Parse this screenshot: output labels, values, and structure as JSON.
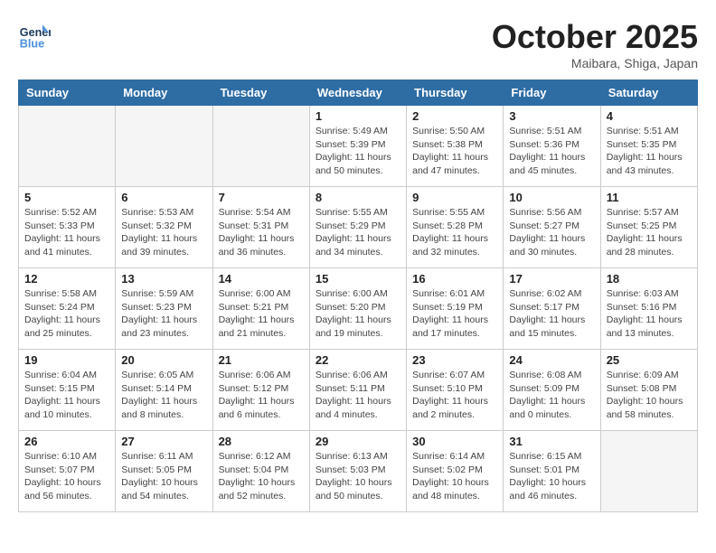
{
  "header": {
    "logo_line1": "General",
    "logo_line2": "Blue",
    "month": "October 2025",
    "location": "Maibara, Shiga, Japan"
  },
  "weekdays": [
    "Sunday",
    "Monday",
    "Tuesday",
    "Wednesday",
    "Thursday",
    "Friday",
    "Saturday"
  ],
  "weeks": [
    [
      {
        "day": "",
        "info": ""
      },
      {
        "day": "",
        "info": ""
      },
      {
        "day": "",
        "info": ""
      },
      {
        "day": "1",
        "info": "Sunrise: 5:49 AM\nSunset: 5:39 PM\nDaylight: 11 hours\nand 50 minutes."
      },
      {
        "day": "2",
        "info": "Sunrise: 5:50 AM\nSunset: 5:38 PM\nDaylight: 11 hours\nand 47 minutes."
      },
      {
        "day": "3",
        "info": "Sunrise: 5:51 AM\nSunset: 5:36 PM\nDaylight: 11 hours\nand 45 minutes."
      },
      {
        "day": "4",
        "info": "Sunrise: 5:51 AM\nSunset: 5:35 PM\nDaylight: 11 hours\nand 43 minutes."
      }
    ],
    [
      {
        "day": "5",
        "info": "Sunrise: 5:52 AM\nSunset: 5:33 PM\nDaylight: 11 hours\nand 41 minutes."
      },
      {
        "day": "6",
        "info": "Sunrise: 5:53 AM\nSunset: 5:32 PM\nDaylight: 11 hours\nand 39 minutes."
      },
      {
        "day": "7",
        "info": "Sunrise: 5:54 AM\nSunset: 5:31 PM\nDaylight: 11 hours\nand 36 minutes."
      },
      {
        "day": "8",
        "info": "Sunrise: 5:55 AM\nSunset: 5:29 PM\nDaylight: 11 hours\nand 34 minutes."
      },
      {
        "day": "9",
        "info": "Sunrise: 5:55 AM\nSunset: 5:28 PM\nDaylight: 11 hours\nand 32 minutes."
      },
      {
        "day": "10",
        "info": "Sunrise: 5:56 AM\nSunset: 5:27 PM\nDaylight: 11 hours\nand 30 minutes."
      },
      {
        "day": "11",
        "info": "Sunrise: 5:57 AM\nSunset: 5:25 PM\nDaylight: 11 hours\nand 28 minutes."
      }
    ],
    [
      {
        "day": "12",
        "info": "Sunrise: 5:58 AM\nSunset: 5:24 PM\nDaylight: 11 hours\nand 25 minutes."
      },
      {
        "day": "13",
        "info": "Sunrise: 5:59 AM\nSunset: 5:23 PM\nDaylight: 11 hours\nand 23 minutes."
      },
      {
        "day": "14",
        "info": "Sunrise: 6:00 AM\nSunset: 5:21 PM\nDaylight: 11 hours\nand 21 minutes."
      },
      {
        "day": "15",
        "info": "Sunrise: 6:00 AM\nSunset: 5:20 PM\nDaylight: 11 hours\nand 19 minutes."
      },
      {
        "day": "16",
        "info": "Sunrise: 6:01 AM\nSunset: 5:19 PM\nDaylight: 11 hours\nand 17 minutes."
      },
      {
        "day": "17",
        "info": "Sunrise: 6:02 AM\nSunset: 5:17 PM\nDaylight: 11 hours\nand 15 minutes."
      },
      {
        "day": "18",
        "info": "Sunrise: 6:03 AM\nSunset: 5:16 PM\nDaylight: 11 hours\nand 13 minutes."
      }
    ],
    [
      {
        "day": "19",
        "info": "Sunrise: 6:04 AM\nSunset: 5:15 PM\nDaylight: 11 hours\nand 10 minutes."
      },
      {
        "day": "20",
        "info": "Sunrise: 6:05 AM\nSunset: 5:14 PM\nDaylight: 11 hours\nand 8 minutes."
      },
      {
        "day": "21",
        "info": "Sunrise: 6:06 AM\nSunset: 5:12 PM\nDaylight: 11 hours\nand 6 minutes."
      },
      {
        "day": "22",
        "info": "Sunrise: 6:06 AM\nSunset: 5:11 PM\nDaylight: 11 hours\nand 4 minutes."
      },
      {
        "day": "23",
        "info": "Sunrise: 6:07 AM\nSunset: 5:10 PM\nDaylight: 11 hours\nand 2 minutes."
      },
      {
        "day": "24",
        "info": "Sunrise: 6:08 AM\nSunset: 5:09 PM\nDaylight: 11 hours\nand 0 minutes."
      },
      {
        "day": "25",
        "info": "Sunrise: 6:09 AM\nSunset: 5:08 PM\nDaylight: 10 hours\nand 58 minutes."
      }
    ],
    [
      {
        "day": "26",
        "info": "Sunrise: 6:10 AM\nSunset: 5:07 PM\nDaylight: 10 hours\nand 56 minutes."
      },
      {
        "day": "27",
        "info": "Sunrise: 6:11 AM\nSunset: 5:05 PM\nDaylight: 10 hours\nand 54 minutes."
      },
      {
        "day": "28",
        "info": "Sunrise: 6:12 AM\nSunset: 5:04 PM\nDaylight: 10 hours\nand 52 minutes."
      },
      {
        "day": "29",
        "info": "Sunrise: 6:13 AM\nSunset: 5:03 PM\nDaylight: 10 hours\nand 50 minutes."
      },
      {
        "day": "30",
        "info": "Sunrise: 6:14 AM\nSunset: 5:02 PM\nDaylight: 10 hours\nand 48 minutes."
      },
      {
        "day": "31",
        "info": "Sunrise: 6:15 AM\nSunset: 5:01 PM\nDaylight: 10 hours\nand 46 minutes."
      },
      {
        "day": "",
        "info": ""
      }
    ]
  ]
}
